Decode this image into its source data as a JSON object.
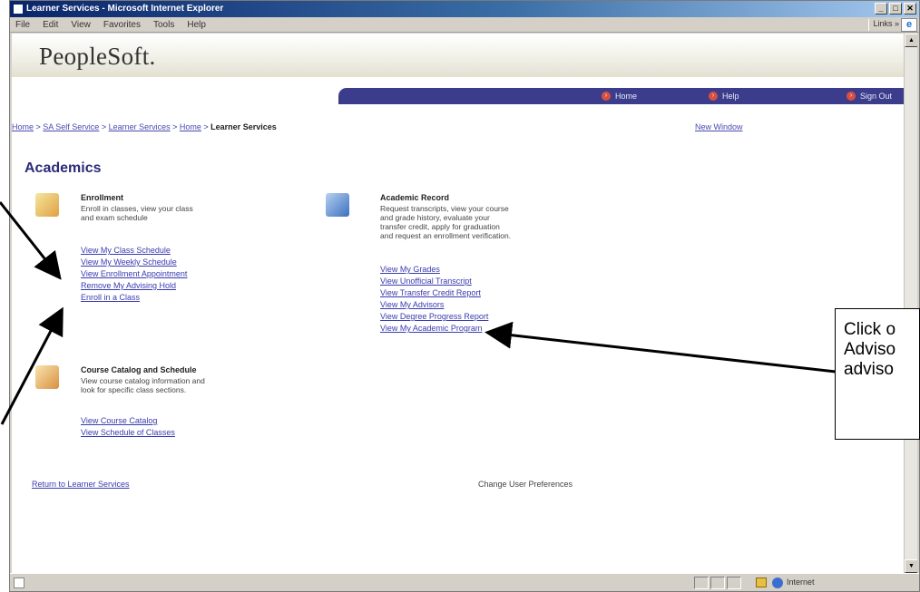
{
  "window": {
    "title": "Learner Services - Microsoft Internet Explorer",
    "menu": [
      "File",
      "Edit",
      "View",
      "Favorites",
      "Tools",
      "Help"
    ],
    "links_label": "Links"
  },
  "app": {
    "logo": "PeopleSoft.",
    "nav": [
      "Home",
      "Help",
      "Sign Out"
    ]
  },
  "breadcrumb": {
    "items": [
      "Home",
      "SA Self Service",
      "Learner Services",
      "Home"
    ],
    "current": "Learner Services",
    "separator": " > ",
    "new_window": "New Window"
  },
  "page_title": "Academics",
  "enrollment": {
    "title": "Enrollment",
    "desc": [
      "Enroll in classes, view your class",
      "and exam schedule"
    ],
    "links": [
      "View My Class Schedule",
      "View My Weekly Schedule",
      "View Enrollment Appointment",
      "Remove My Advising Hold",
      "Enroll in a Class"
    ]
  },
  "academic_record": {
    "title": "Academic Record",
    "desc": [
      "Request transcripts, view your course",
      "and grade history, evaluate your",
      "transfer credit, apply for graduation",
      "and request an enrollment verification."
    ],
    "links": [
      "View My Grades",
      "View Unofficial Transcript",
      "View Transfer Credit Report",
      "View My Advisors",
      "View Degree Progress Report",
      "View My Academic Program"
    ]
  },
  "catalog": {
    "title": "Course Catalog and Schedule",
    "desc": [
      "View course catalog information and",
      "look for specific class sections."
    ],
    "links": [
      "View Course Catalog",
      "View Schedule of Classes"
    ]
  },
  "footer": {
    "return_link": "Return to Learner Services",
    "prefs": "Change User Preferences"
  },
  "status": {
    "zone": "Internet"
  },
  "callout": {
    "lines": [
      "Click o",
      "Adviso",
      "adviso"
    ]
  },
  "colors": {
    "nav_bar": "#3b3d8c",
    "link": "#3a3ab0",
    "title": "#2a2a7a"
  }
}
